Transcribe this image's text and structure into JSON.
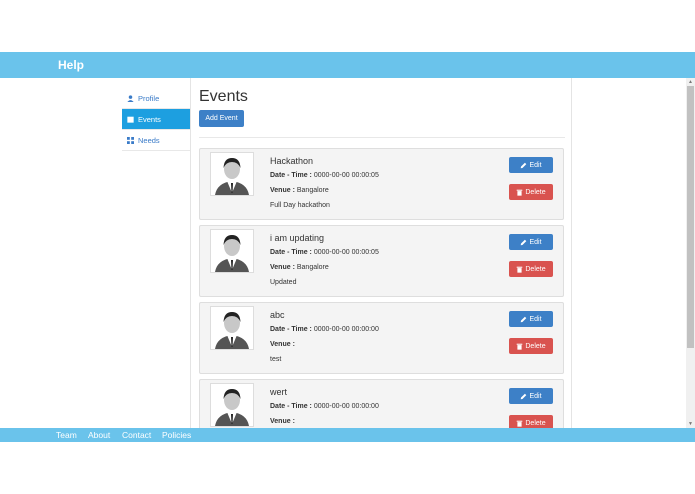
{
  "header": {
    "brand": "Help"
  },
  "sidebar": {
    "items": [
      {
        "label": "Profile",
        "icon": "user-icon",
        "active": false
      },
      {
        "label": "Events",
        "icon": "calendar-icon",
        "active": true
      },
      {
        "label": "Needs",
        "icon": "grid-icon",
        "active": false
      }
    ]
  },
  "main": {
    "title": "Events",
    "add_button": "Add Event",
    "edit_label": "Edit",
    "delete_label": "Delete",
    "date_label": "Date - Time :",
    "venue_label": "Venue :",
    "events": [
      {
        "name": "Hackathon",
        "datetime": "0000-00-00 00:00:05",
        "venue": "Bangalore",
        "description": "Full Day hackathon"
      },
      {
        "name": "i am updating",
        "datetime": "0000-00-00 00:00:05",
        "venue": "Bangalore",
        "description": "Updated"
      },
      {
        "name": "abc",
        "datetime": "0000-00-00 00:00:00",
        "venue": "",
        "description": "test"
      },
      {
        "name": "wert",
        "datetime": "0000-00-00 00:00:00",
        "venue": "",
        "description": ""
      }
    ]
  },
  "footer": {
    "links": [
      "Team",
      "About",
      "Contact",
      "Policies"
    ]
  },
  "colors": {
    "accent": "#6ac3eb",
    "primary": "#3d80c7",
    "danger": "#d9534f",
    "active": "#1d9fe0"
  }
}
